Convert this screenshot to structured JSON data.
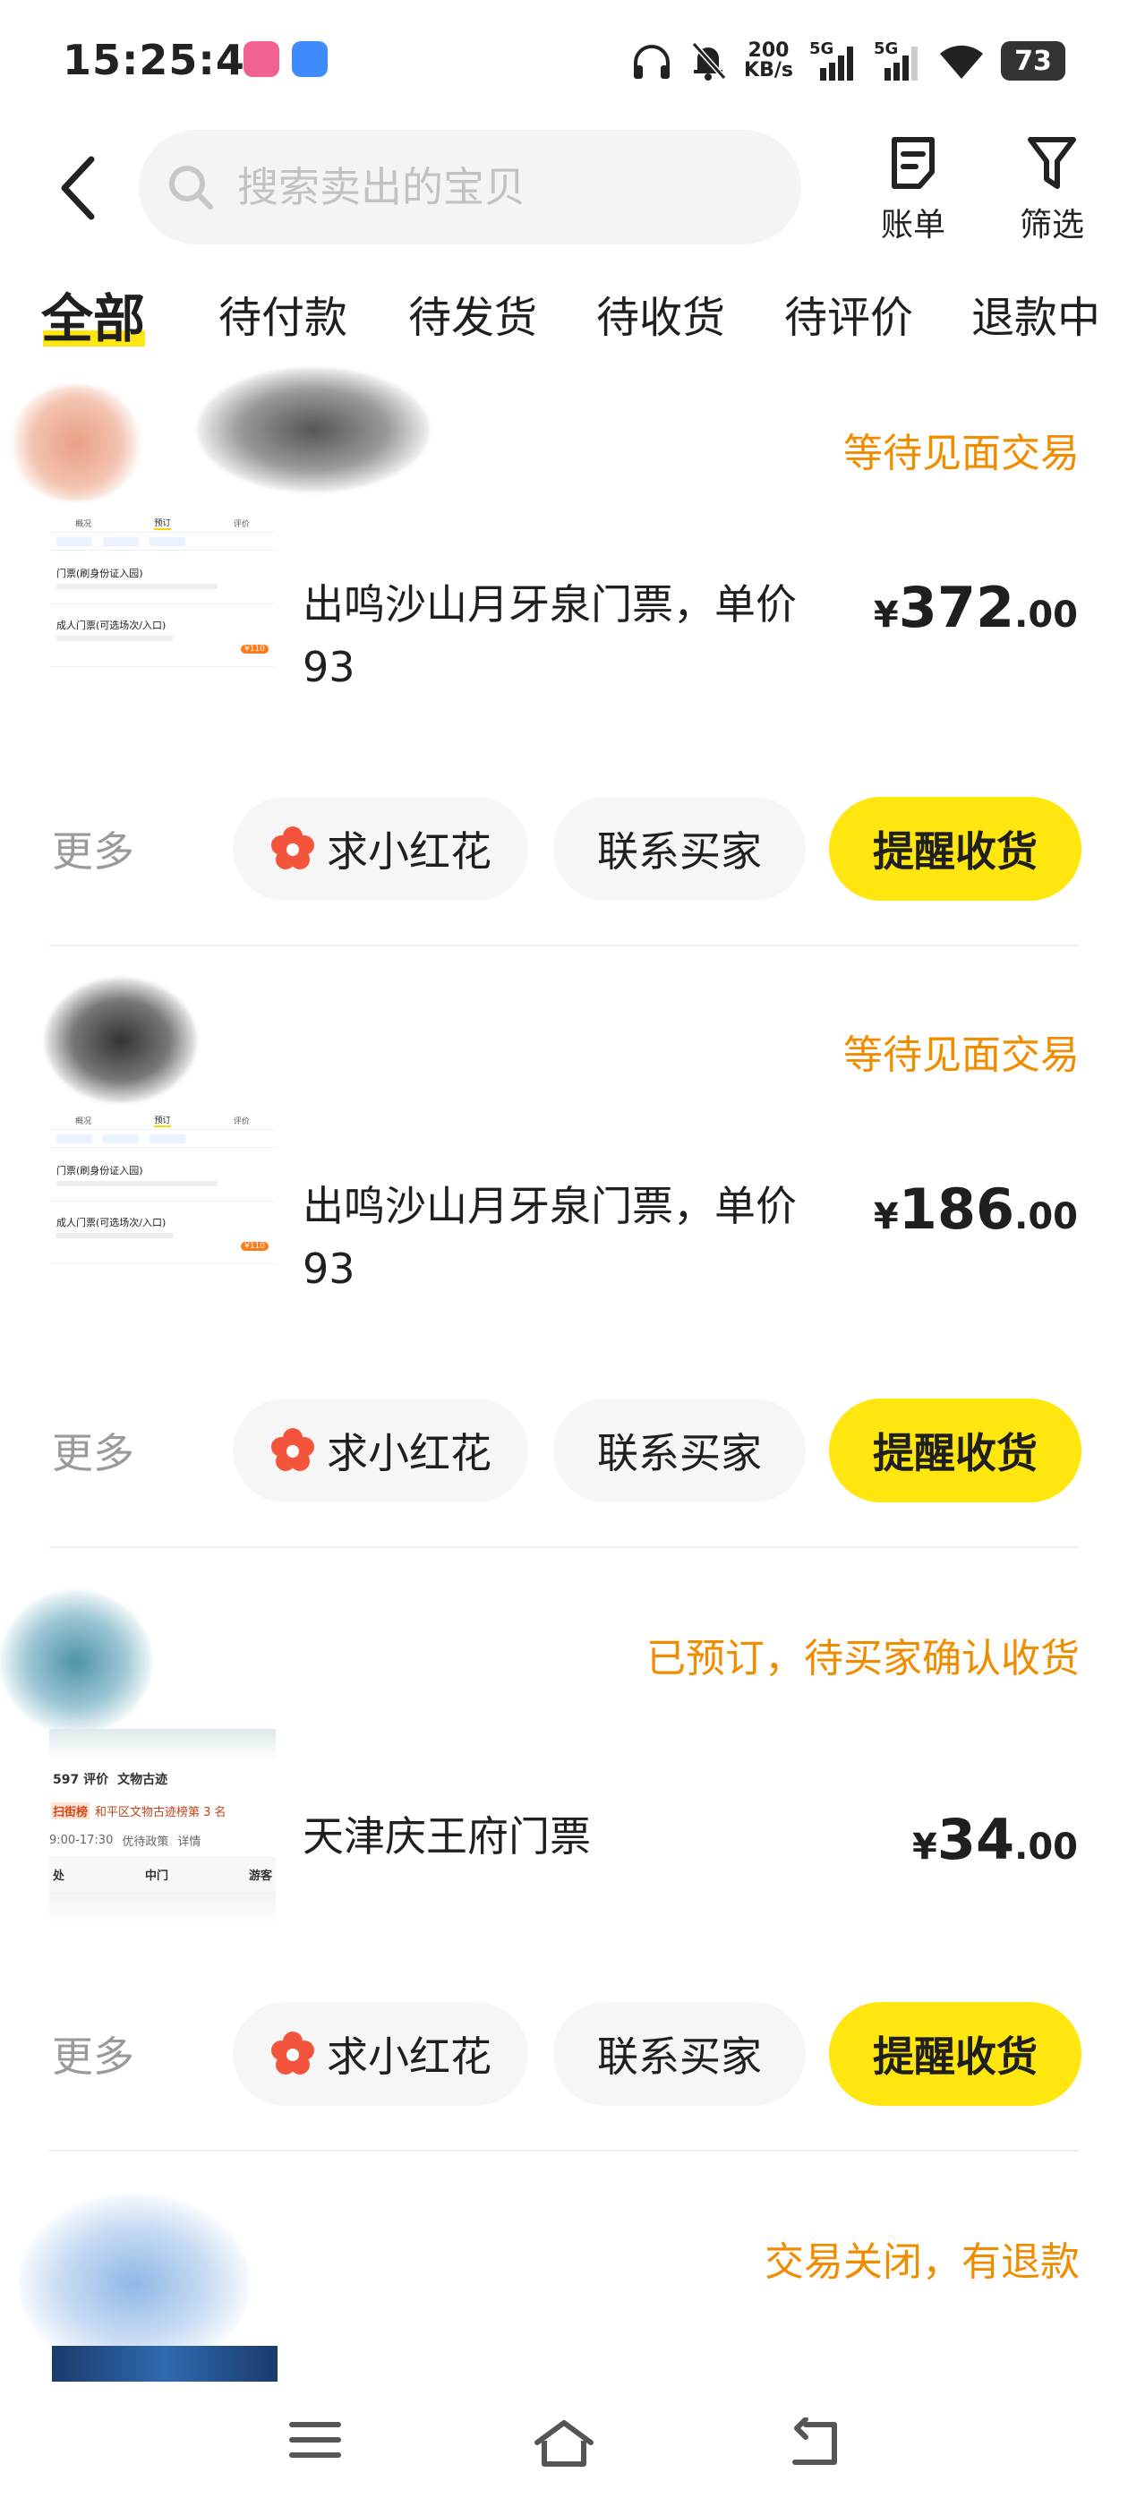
{
  "status_bar": {
    "time": "15:25:41",
    "net_speed_value": "200",
    "net_speed_unit": "KB/s",
    "sim1": "5G",
    "sim2": "5G",
    "battery": "73"
  },
  "header": {
    "search_placeholder": "搜索卖出的宝贝",
    "bill_label": "账单",
    "filter_label": "筛选"
  },
  "tabs": [
    {
      "label": "全部",
      "active": true
    },
    {
      "label": "待付款"
    },
    {
      "label": "待发货"
    },
    {
      "label": "待收货"
    },
    {
      "label": "待评价"
    },
    {
      "label": "退款中"
    }
  ],
  "orders": [
    {
      "status": "等待见面交易",
      "title": "出鸣沙山月牙泉门票，单价93",
      "price_currency": "¥",
      "price_int": "372",
      "price_dec": ".00",
      "more": "更多",
      "btn_flower": "求小红花",
      "btn_contact": "联系买家",
      "btn_remind": "提醒收货"
    },
    {
      "status": "等待见面交易",
      "title": "出鸣沙山月牙泉门票，单价93",
      "price_currency": "¥",
      "price_int": "186",
      "price_dec": ".00",
      "more": "更多",
      "btn_flower": "求小红花",
      "btn_contact": "联系买家",
      "btn_remind": "提醒收货"
    },
    {
      "status": "已预订，待买家确认收货",
      "title": "天津庆王府门票",
      "price_currency": "¥",
      "price_int": "34",
      "price_dec": ".00",
      "more": "更多",
      "btn_flower": "求小红花",
      "btn_contact": "联系买家",
      "btn_remind": "提醒收货"
    },
    {
      "status": "交易关闭，有退款"
    }
  ],
  "thumb_text": {
    "mini_tabs": [
      "概况",
      "预订",
      "评价"
    ],
    "mini_title": "门票(刷身份证入园)",
    "mini_sub": "成人门票(可选场次/入口)",
    "mini_price": "¥110",
    "t3_reviews": "597 评价",
    "t3_cat": "文物古迹",
    "t3_rank_tag": "扫街榜",
    "t3_rank": "和平区文物古迹榜第 3 名",
    "t3_hours": "9:00-17:30",
    "t3_policy": "优待政策",
    "t3_detail": "详情",
    "t3_col1": "处",
    "t3_col2": "中门",
    "t3_col3": "游客"
  },
  "colors": {
    "accent_yellow": "#ffe60f",
    "status_orange": "#f08c00",
    "pill_gray": "#f6f6f6"
  },
  "icons": {
    "back": "chevron-left-icon",
    "search": "search-icon",
    "bill": "bill-icon",
    "filter": "filter-icon",
    "flower": "flower-icon",
    "nav_menu": "menu-icon",
    "nav_home": "home-icon",
    "nav_back": "back-icon"
  }
}
